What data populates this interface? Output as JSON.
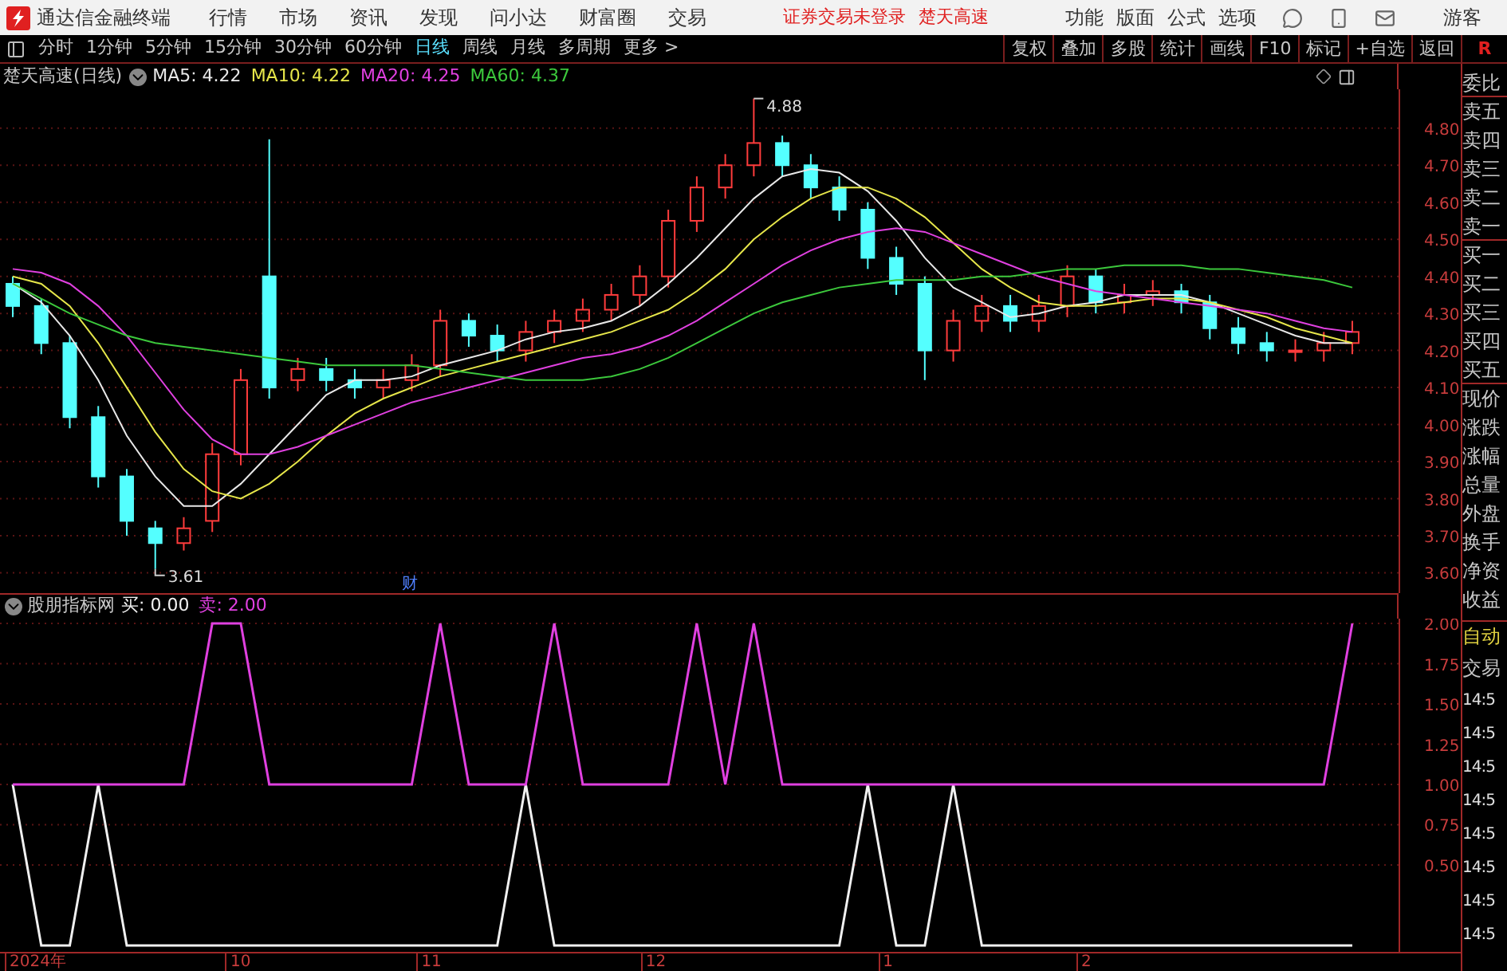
{
  "app": {
    "title": "通达信金融终端",
    "menus": [
      "行情",
      "市场",
      "资讯",
      "发现",
      "问小达",
      "财富圈",
      "交易"
    ],
    "notices": [
      "证券交易未登录",
      "楚天高速"
    ],
    "tools": [
      "功能",
      "版面",
      "公式",
      "选项"
    ],
    "user": "游客"
  },
  "periods": [
    {
      "label": "分时",
      "selected": false
    },
    {
      "label": "1分钟",
      "selected": false
    },
    {
      "label": "5分钟",
      "selected": false
    },
    {
      "label": "15分钟",
      "selected": false
    },
    {
      "label": "30分钟",
      "selected": false
    },
    {
      "label": "60分钟",
      "selected": false
    },
    {
      "label": "日线",
      "selected": true
    },
    {
      "label": "周线",
      "selected": false
    },
    {
      "label": "月线",
      "selected": false
    },
    {
      "label": "多周期",
      "selected": false
    },
    {
      "label": "更多 >",
      "selected": false
    }
  ],
  "actions": [
    "复权",
    "叠加",
    "多股",
    "统计",
    "画线",
    "F10",
    "标记",
    "+自选",
    "返回"
  ],
  "corner": "R",
  "price_panel": {
    "title": "楚天高速(日线)",
    "readings": [
      "MA5: 4.22",
      "MA10: 4.22",
      "MA20: 4.25",
      "MA60: 4.37"
    ],
    "chart_data": {
      "type": "candlestick",
      "grid": true,
      "ylim": [
        3.545,
        4.905
      ],
      "yticks": [
        {
          "value": 3.6,
          "label": "3.60"
        },
        {
          "value": 3.7,
          "label": "3.70"
        },
        {
          "value": 3.8,
          "label": "3.80"
        },
        {
          "value": 3.9,
          "label": "3.90"
        },
        {
          "value": 4.0,
          "label": "4.00"
        },
        {
          "value": 4.1,
          "label": "4.10"
        },
        {
          "value": 4.2,
          "label": "4.20"
        },
        {
          "value": 4.3,
          "label": "4.30"
        },
        {
          "value": 4.4,
          "label": "4.40"
        },
        {
          "value": 4.5,
          "label": "4.50"
        },
        {
          "value": 4.6,
          "label": "4.60"
        },
        {
          "value": 4.7,
          "label": "4.70"
        },
        {
          "value": 4.8,
          "label": "4.80"
        }
      ],
      "ohlc": [
        [
          4.38,
          4.4,
          4.29,
          4.32
        ],
        [
          4.32,
          4.34,
          4.19,
          4.22
        ],
        [
          4.22,
          4.24,
          3.99,
          4.02
        ],
        [
          4.02,
          4.05,
          3.83,
          3.86
        ],
        [
          3.86,
          3.88,
          3.7,
          3.74
        ],
        [
          3.72,
          3.74,
          3.61,
          3.68
        ],
        [
          3.68,
          3.75,
          3.66,
          3.72
        ],
        [
          3.74,
          3.95,
          3.71,
          3.92
        ],
        [
          3.92,
          4.15,
          3.89,
          4.12
        ],
        [
          4.4,
          4.77,
          4.07,
          4.1
        ],
        [
          4.12,
          4.18,
          4.09,
          4.15
        ],
        [
          4.15,
          4.18,
          4.09,
          4.12
        ],
        [
          4.12,
          4.15,
          4.07,
          4.1
        ],
        [
          4.1,
          4.15,
          4.07,
          4.12
        ],
        [
          4.12,
          4.19,
          4.09,
          4.16
        ],
        [
          4.16,
          4.31,
          4.13,
          4.28
        ],
        [
          4.28,
          4.3,
          4.21,
          4.24
        ],
        [
          4.24,
          4.27,
          4.17,
          4.2
        ],
        [
          4.2,
          4.28,
          4.17,
          4.25
        ],
        [
          4.25,
          4.31,
          4.22,
          4.28
        ],
        [
          4.28,
          4.34,
          4.25,
          4.31
        ],
        [
          4.31,
          4.38,
          4.28,
          4.35
        ],
        [
          4.35,
          4.43,
          4.32,
          4.4
        ],
        [
          4.4,
          4.58,
          4.37,
          4.55
        ],
        [
          4.55,
          4.67,
          4.52,
          4.64
        ],
        [
          4.64,
          4.73,
          4.61,
          4.7
        ],
        [
          4.7,
          4.88,
          4.67,
          4.76
        ],
        [
          4.76,
          4.78,
          4.67,
          4.7
        ],
        [
          4.7,
          4.73,
          4.61,
          4.64
        ],
        [
          4.64,
          4.67,
          4.55,
          4.58
        ],
        [
          4.58,
          4.6,
          4.42,
          4.45
        ],
        [
          4.45,
          4.48,
          4.35,
          4.38
        ],
        [
          4.38,
          4.4,
          4.12,
          4.2
        ],
        [
          4.2,
          4.31,
          4.17,
          4.28
        ],
        [
          4.28,
          4.35,
          4.25,
          4.32
        ],
        [
          4.32,
          4.35,
          4.25,
          4.28
        ],
        [
          4.28,
          4.35,
          4.25,
          4.32
        ],
        [
          4.32,
          4.43,
          4.29,
          4.4
        ],
        [
          4.4,
          4.42,
          4.3,
          4.33
        ],
        [
          4.33,
          4.38,
          4.3,
          4.35
        ],
        [
          4.35,
          4.39,
          4.32,
          4.36
        ],
        [
          4.36,
          4.38,
          4.3,
          4.33
        ],
        [
          4.33,
          4.35,
          4.23,
          4.26
        ],
        [
          4.26,
          4.29,
          4.19,
          4.22
        ],
        [
          4.22,
          4.25,
          4.17,
          4.2
        ],
        [
          4.2,
          4.23,
          4.17,
          4.2
        ],
        [
          4.2,
          4.25,
          4.17,
          4.22
        ],
        [
          4.22,
          4.28,
          4.19,
          4.25
        ]
      ],
      "series": [
        {
          "type": "line",
          "color": "#e8e8e8",
          "values": [
            4.38,
            4.33,
            4.24,
            4.12,
            3.97,
            3.86,
            3.78,
            3.78,
            3.84,
            3.92,
            4.0,
            4.08,
            4.12,
            4.12,
            4.13,
            4.16,
            4.18,
            4.2,
            4.23,
            4.25,
            4.26,
            4.28,
            4.32,
            4.38,
            4.45,
            4.53,
            4.61,
            4.67,
            4.69,
            4.68,
            4.63,
            4.55,
            4.45,
            4.37,
            4.33,
            4.29,
            4.3,
            4.32,
            4.33,
            4.35,
            4.35,
            4.35,
            4.33,
            4.3,
            4.27,
            4.24,
            4.22,
            4.22
          ]
        },
        {
          "type": "line",
          "color": "#e6e64a",
          "values": [
            4.4,
            4.38,
            4.32,
            4.22,
            4.1,
            3.98,
            3.88,
            3.82,
            3.8,
            3.84,
            3.9,
            3.97,
            4.03,
            4.07,
            4.1,
            4.13,
            4.15,
            4.17,
            4.19,
            4.21,
            4.23,
            4.25,
            4.28,
            4.31,
            4.36,
            4.42,
            4.5,
            4.56,
            4.61,
            4.64,
            4.64,
            4.61,
            4.56,
            4.49,
            4.42,
            4.37,
            4.33,
            4.32,
            4.32,
            4.33,
            4.34,
            4.34,
            4.33,
            4.31,
            4.29,
            4.26,
            4.24,
            4.22
          ]
        },
        {
          "type": "line",
          "color": "#e040e0",
          "values": [
            4.42,
            4.41,
            4.38,
            4.32,
            4.24,
            4.14,
            4.04,
            3.96,
            3.92,
            3.92,
            3.94,
            3.97,
            4.0,
            4.03,
            4.06,
            4.08,
            4.1,
            4.12,
            4.14,
            4.16,
            4.18,
            4.19,
            4.21,
            4.24,
            4.28,
            4.33,
            4.38,
            4.43,
            4.47,
            4.5,
            4.52,
            4.53,
            4.52,
            4.49,
            4.46,
            4.43,
            4.4,
            4.38,
            4.36,
            4.35,
            4.34,
            4.33,
            4.32,
            4.31,
            4.3,
            4.28,
            4.26,
            4.25
          ]
        },
        {
          "type": "line",
          "color": "#3cc83c",
          "values": [
            4.38,
            4.34,
            4.3,
            4.27,
            4.24,
            4.22,
            4.21,
            4.2,
            4.19,
            4.18,
            4.17,
            4.16,
            4.16,
            4.16,
            4.16,
            4.15,
            4.14,
            4.13,
            4.12,
            4.12,
            4.12,
            4.13,
            4.15,
            4.18,
            4.22,
            4.26,
            4.3,
            4.33,
            4.35,
            4.37,
            4.38,
            4.39,
            4.39,
            4.39,
            4.4,
            4.4,
            4.41,
            4.42,
            4.42,
            4.43,
            4.43,
            4.43,
            4.42,
            4.42,
            4.41,
            4.4,
            4.39,
            4.37
          ]
        }
      ],
      "annotations": [
        "4.88",
        "3.61",
        "财"
      ]
    }
  },
  "indicator_panel": {
    "title": "股朋指标网",
    "readings": [
      "买: 0.00",
      "卖: 2.00"
    ],
    "chart_data": {
      "type": "line",
      "grid": true,
      "ylim": [
        -0.04,
        2.03
      ],
      "yticks": [
        {
          "value": 0.5,
          "label": "0.50"
        },
        {
          "value": 0.75,
          "label": "0.75"
        },
        {
          "value": 1.0,
          "label": "1.00"
        },
        {
          "value": 1.25,
          "label": "1.25"
        },
        {
          "value": 1.5,
          "label": "1.50"
        },
        {
          "value": 1.75,
          "label": "1.75"
        },
        {
          "value": 2.0,
          "label": "2.00"
        }
      ],
      "series": [
        {
          "color": "#f0f0f0",
          "values": [
            1,
            0,
            0,
            1,
            0,
            0,
            0,
            0,
            0,
            0,
            0,
            0,
            0,
            0,
            0,
            0,
            0,
            0,
            1,
            0,
            0,
            0,
            0,
            0,
            0,
            0,
            0,
            0,
            0,
            0,
            1,
            0,
            0,
            1,
            0,
            0,
            0,
            0,
            0,
            0,
            0,
            0,
            0,
            0,
            0,
            0,
            0,
            0
          ]
        },
        {
          "color": "#e040e0",
          "values": [
            1,
            1,
            1,
            1,
            1,
            1,
            1,
            2,
            2,
            1,
            1,
            1,
            1,
            1,
            1,
            2,
            1,
            1,
            1,
            2,
            1,
            1,
            1,
            1,
            2,
            1,
            2,
            1,
            1,
            1,
            1,
            1,
            1,
            1,
            1,
            1,
            1,
            1,
            1,
            1,
            1,
            1,
            1,
            1,
            1,
            1,
            1,
            2
          ]
        }
      ]
    }
  },
  "date_axis": [
    "2024年",
    "10",
    "11",
    "12",
    "1",
    "2"
  ],
  "quote_panel": {
    "labels": [
      "委比",
      "卖五",
      "卖四",
      "卖三",
      "卖二",
      "卖一",
      "买一",
      "买二",
      "买三",
      "买四",
      "买五",
      "现价",
      "涨跌",
      "涨幅",
      "总量",
      "外盘",
      "换手",
      "净资",
      "收益"
    ],
    "auto_label": "自动",
    "trade_label": "交易",
    "times": [
      "14:5",
      "14:5",
      "14:5",
      "14:5",
      "14:5",
      "14:5",
      "14:5",
      "14:5"
    ]
  }
}
